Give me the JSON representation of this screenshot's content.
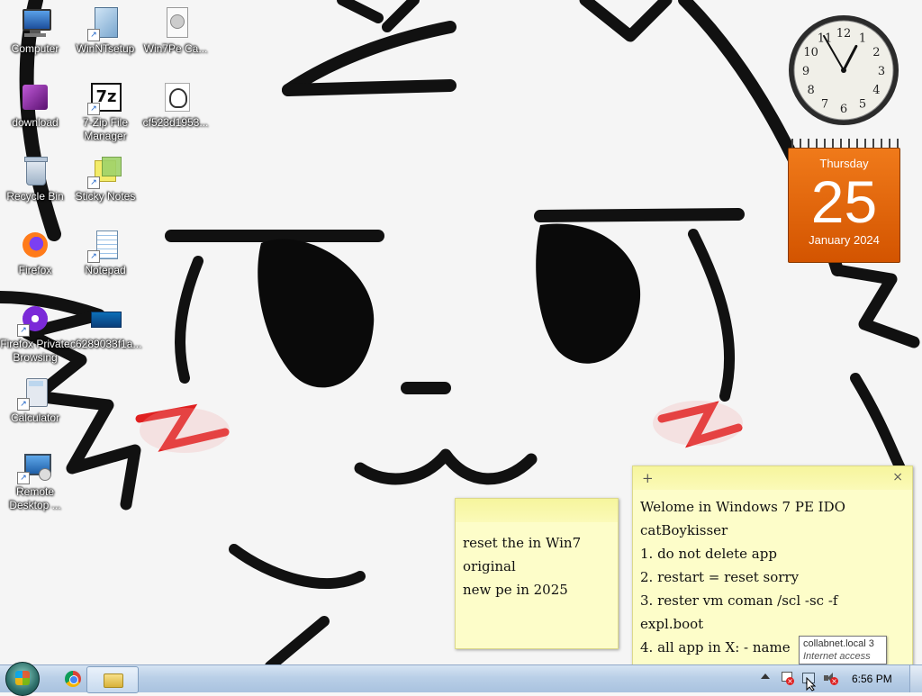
{
  "desktop_icons": [
    {
      "label": "Computer"
    },
    {
      "label": "WinNTsetup"
    },
    {
      "label": "Win7Pe Ca..."
    },
    {
      "label": "download"
    },
    {
      "label": "7-Zip File Manager"
    },
    {
      "label": "cf523d1953..."
    },
    {
      "label": "Recycle Bin"
    },
    {
      "label": "Sticky Notes"
    },
    {
      "label": "Firefox"
    },
    {
      "label": "Notepad"
    },
    {
      "label": "Firefox Private Browsing"
    },
    {
      "label": "c6289033f1a..."
    },
    {
      "label": "Calculator"
    },
    {
      "label": "Remote Desktop ..."
    }
  ],
  "clock_gadget": {
    "hour": 12,
    "minute": 55
  },
  "calendar_gadget": {
    "weekday": "Thursday",
    "day": "25",
    "month_year": "January 2024"
  },
  "sticky_notes": [
    {
      "text": "reset the in Win7\noriginal\nnew pe in 2025"
    },
    {
      "plus": "+",
      "close": "×",
      "text": "Welome in Windows 7 PE IDO\ncatBoykisser\n1. do not delete app\n2. restart = reset sorry\n3. rester vm coman /scl -sc -f\nexpl.boot\n4. all app in X: - name"
    }
  ],
  "tooltip": {
    "line1": "collabnet.local  3",
    "line2": "Internet access"
  },
  "taskbar": {
    "time": "6:56 PM",
    "pinned": [
      {
        "name": "chrome"
      },
      {
        "name": "explorer"
      }
    ]
  },
  "colors": {
    "calendar": "#e8650d",
    "note": "#fdfdc9",
    "taskbar": "#b9cfe7"
  }
}
